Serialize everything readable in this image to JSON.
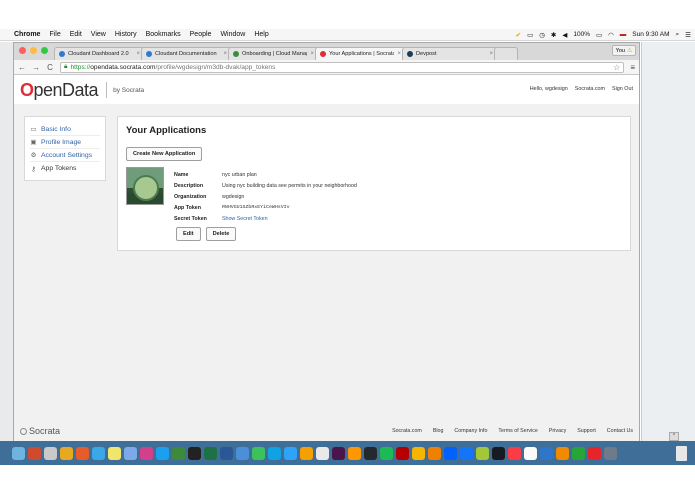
{
  "menubar": {
    "apple": "",
    "menus": [
      "Chrome",
      "File",
      "Edit",
      "View",
      "History",
      "Bookmarks",
      "People",
      "Window",
      "Help"
    ],
    "battery": "100%",
    "clock": "Sun 9:30 AM"
  },
  "browser": {
    "tabs": [
      {
        "label": "Cloudant Dashboard 2.0",
        "color": "#2e7ad1"
      },
      {
        "label": "Cloudant Documentation",
        "color": "#2e7ad1"
      },
      {
        "label": "Onboarding | Cloud Manag",
        "color": "#3c8d3c"
      },
      {
        "label": "Your Applications | Socrata",
        "color": "#e12d39"
      },
      {
        "label": "Devpost",
        "color": "#1b3a57"
      }
    ],
    "profile_label": "You",
    "url": {
      "scheme": "https://",
      "host": "opendata.socrata.com",
      "path": "/profile/wgdesign/m3db-dvak/app_tokens"
    }
  },
  "site": {
    "logo_prefix": "O",
    "logo_rest": "penData",
    "by": "by Socrata",
    "header_links": [
      "Hello, wgdesign",
      "Socrata.com",
      "Sign Out"
    ]
  },
  "sidebar": {
    "items": [
      {
        "label": "Basic Info",
        "icon": "id-card-icon",
        "glyph": "▭"
      },
      {
        "label": "Profile Image",
        "icon": "image-icon",
        "glyph": "▣"
      },
      {
        "label": "Account Settings",
        "icon": "gear-icon",
        "glyph": "⚙"
      },
      {
        "label": "App Tokens",
        "icon": "key-icon",
        "glyph": "⚷"
      }
    ]
  },
  "main": {
    "title": "Your Applications",
    "create_button": "Create New Application",
    "app": {
      "fields": [
        {
          "key": "Name",
          "value": "nyc urban plan"
        },
        {
          "key": "Description",
          "value": "Using nyc building data see permits in your neighborhood"
        },
        {
          "key": "Organization",
          "value": "wgdesign"
        },
        {
          "key": "App Token",
          "value": "RNHVGU1SZbRxEYiCeWHsVIv"
        },
        {
          "key": "Secret Token",
          "value": "Show Secret Token"
        }
      ],
      "edit_button": "Edit",
      "delete_button": "Delete"
    }
  },
  "footer": {
    "logo": "Socrata",
    "links": [
      "Socrata.com",
      "Blog",
      "Company Info",
      "Terms of Service",
      "Privacy",
      "Support",
      "Contact Us"
    ]
  },
  "dock": {
    "icons": [
      "finder-icon",
      "launchpad-icon",
      "safari-icon",
      "mail-icon",
      "chrome-icon",
      "firefox-icon",
      "notes-icon",
      "photos-icon",
      "itunes-icon",
      "app-store-icon",
      "maps-icon",
      "terminal-icon",
      "excel-icon",
      "word-icon",
      "preview-icon",
      "messages-icon",
      "skype-icon",
      "photoshop-icon",
      "illustrator-icon",
      "calendar-icon",
      "slack-icon",
      "sublime-icon",
      "github-icon",
      "spotify-icon",
      "filezilla-icon",
      "sketch-icon",
      "vlc-icon",
      "dropbox-icon",
      "xcode-icon",
      "android-icon",
      "steam-icon",
      "music-icon",
      "reminders-icon",
      "keynote-icon",
      "pages-icon",
      "numbers-icon",
      "acrobat-icon",
      "downloads-icon"
    ],
    "colors": [
      "#6fb3e0",
      "#d04a2e",
      "#c9c9c9",
      "#e6a91f",
      "#e85b2b",
      "#3ba7e6",
      "#f1e66b",
      "#7ea9e8",
      "#d33f8a",
      "#1aa0ec",
      "#3d8a3a",
      "#222",
      "#1e7145",
      "#2b5797",
      "#4a90d9",
      "#3cc25a",
      "#10a2e2",
      "#2fa3f7",
      "#f59f00",
      "#e9e9e9",
      "#4a154b",
      "#ff9800",
      "#24292e",
      "#1db954",
      "#b40000",
      "#f7b500",
      "#f08000",
      "#0061ff",
      "#1575f9",
      "#a4c639",
      "#171a21",
      "#fc3c44",
      "#fafafa",
      "#2f75c9",
      "#f08a00",
      "#26a639",
      "#e5252a",
      "#6d7b8a"
    ]
  }
}
